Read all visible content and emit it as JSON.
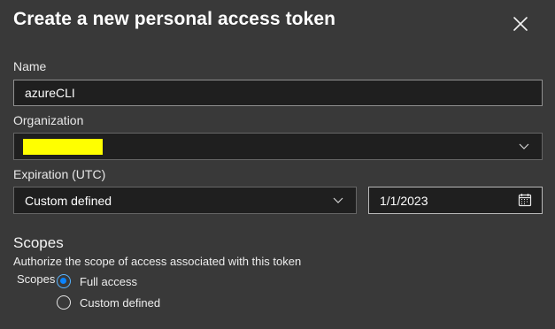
{
  "dialog": {
    "title": "Create a new personal access token",
    "close_icon": "close-icon"
  },
  "name": {
    "label": "Name",
    "value": "azureCLI"
  },
  "organization": {
    "label": "Organization",
    "redaction_color": "#ffff00",
    "chevron_icon": "chevron-down-icon"
  },
  "expiration": {
    "label": "Expiration (UTC)",
    "select_value": "Custom defined",
    "date_value": "1/1/2023",
    "chevron_icon": "chevron-down-icon",
    "calendar_icon": "calendar-icon"
  },
  "scopes": {
    "heading": "Scopes",
    "description": "Authorize the scope of access associated with this token",
    "label": "Scopes",
    "options": [
      {
        "label": "Full access",
        "checked": true
      },
      {
        "label": "Custom defined",
        "checked": false
      }
    ]
  },
  "colors": {
    "background": "#393939",
    "input_background": "#1f1f1f",
    "accent": "#0a84ff"
  }
}
